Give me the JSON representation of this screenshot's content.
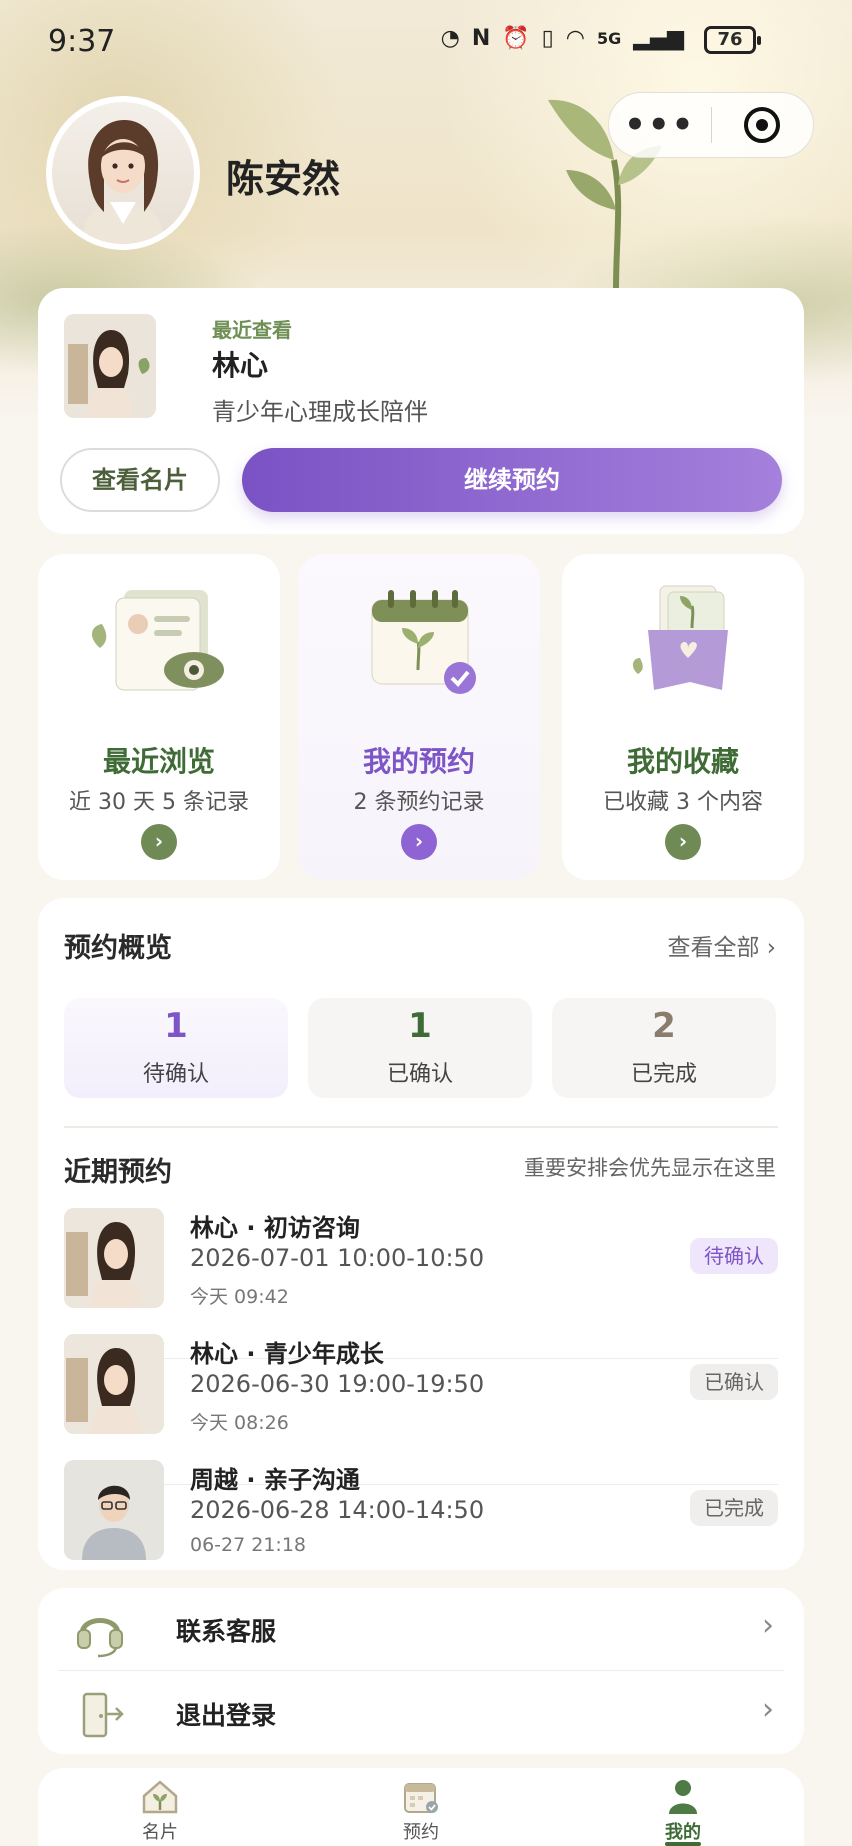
{
  "status_bar": {
    "time": "9:37",
    "network": "5G",
    "battery": "76"
  },
  "profile": {
    "name": "陈安然"
  },
  "recent_view": {
    "tag": "最近查看",
    "name": "林心",
    "desc": "青少年心理成长陪伴",
    "view_card": "查看名片",
    "continue_booking": "继续预约"
  },
  "tiles": [
    {
      "title": "最近浏览",
      "sub": "近 30 天 5 条记录"
    },
    {
      "title": "我的预约",
      "sub": "2 条预约记录"
    },
    {
      "title": "我的收藏",
      "sub": "已收藏 3 个内容"
    }
  ],
  "overview": {
    "title": "预约概览",
    "view_all": "查看全部 ›",
    "stats": [
      {
        "n": "1",
        "label": "待确认"
      },
      {
        "n": "1",
        "label": "已确认"
      },
      {
        "n": "2",
        "label": "已完成"
      }
    ],
    "recent_title": "近期预约",
    "recent_note": "重要安排会优先显示在这里",
    "items": [
      {
        "title": "林心 · 初访咨询",
        "time": "2026-07-01 10:00-10:50",
        "created": "今天 09:42",
        "status": "待确认"
      },
      {
        "title": "林心 · 青少年成长",
        "time": "2026-06-30 19:00-19:50",
        "created": "今天 08:26",
        "status": "已确认"
      },
      {
        "title": "周越 · 亲子沟通",
        "time": "2026-06-28 14:00-14:50",
        "created": "06-27 21:18",
        "status": "已完成"
      }
    ]
  },
  "menu": {
    "service": "联系客服",
    "logout": "退出登录"
  },
  "tabbar": {
    "card": "名片",
    "booking": "预约",
    "mine": "我的"
  },
  "colors": {
    "brand_green": "#3f6b36",
    "accent_purple": "#7d55c7"
  }
}
